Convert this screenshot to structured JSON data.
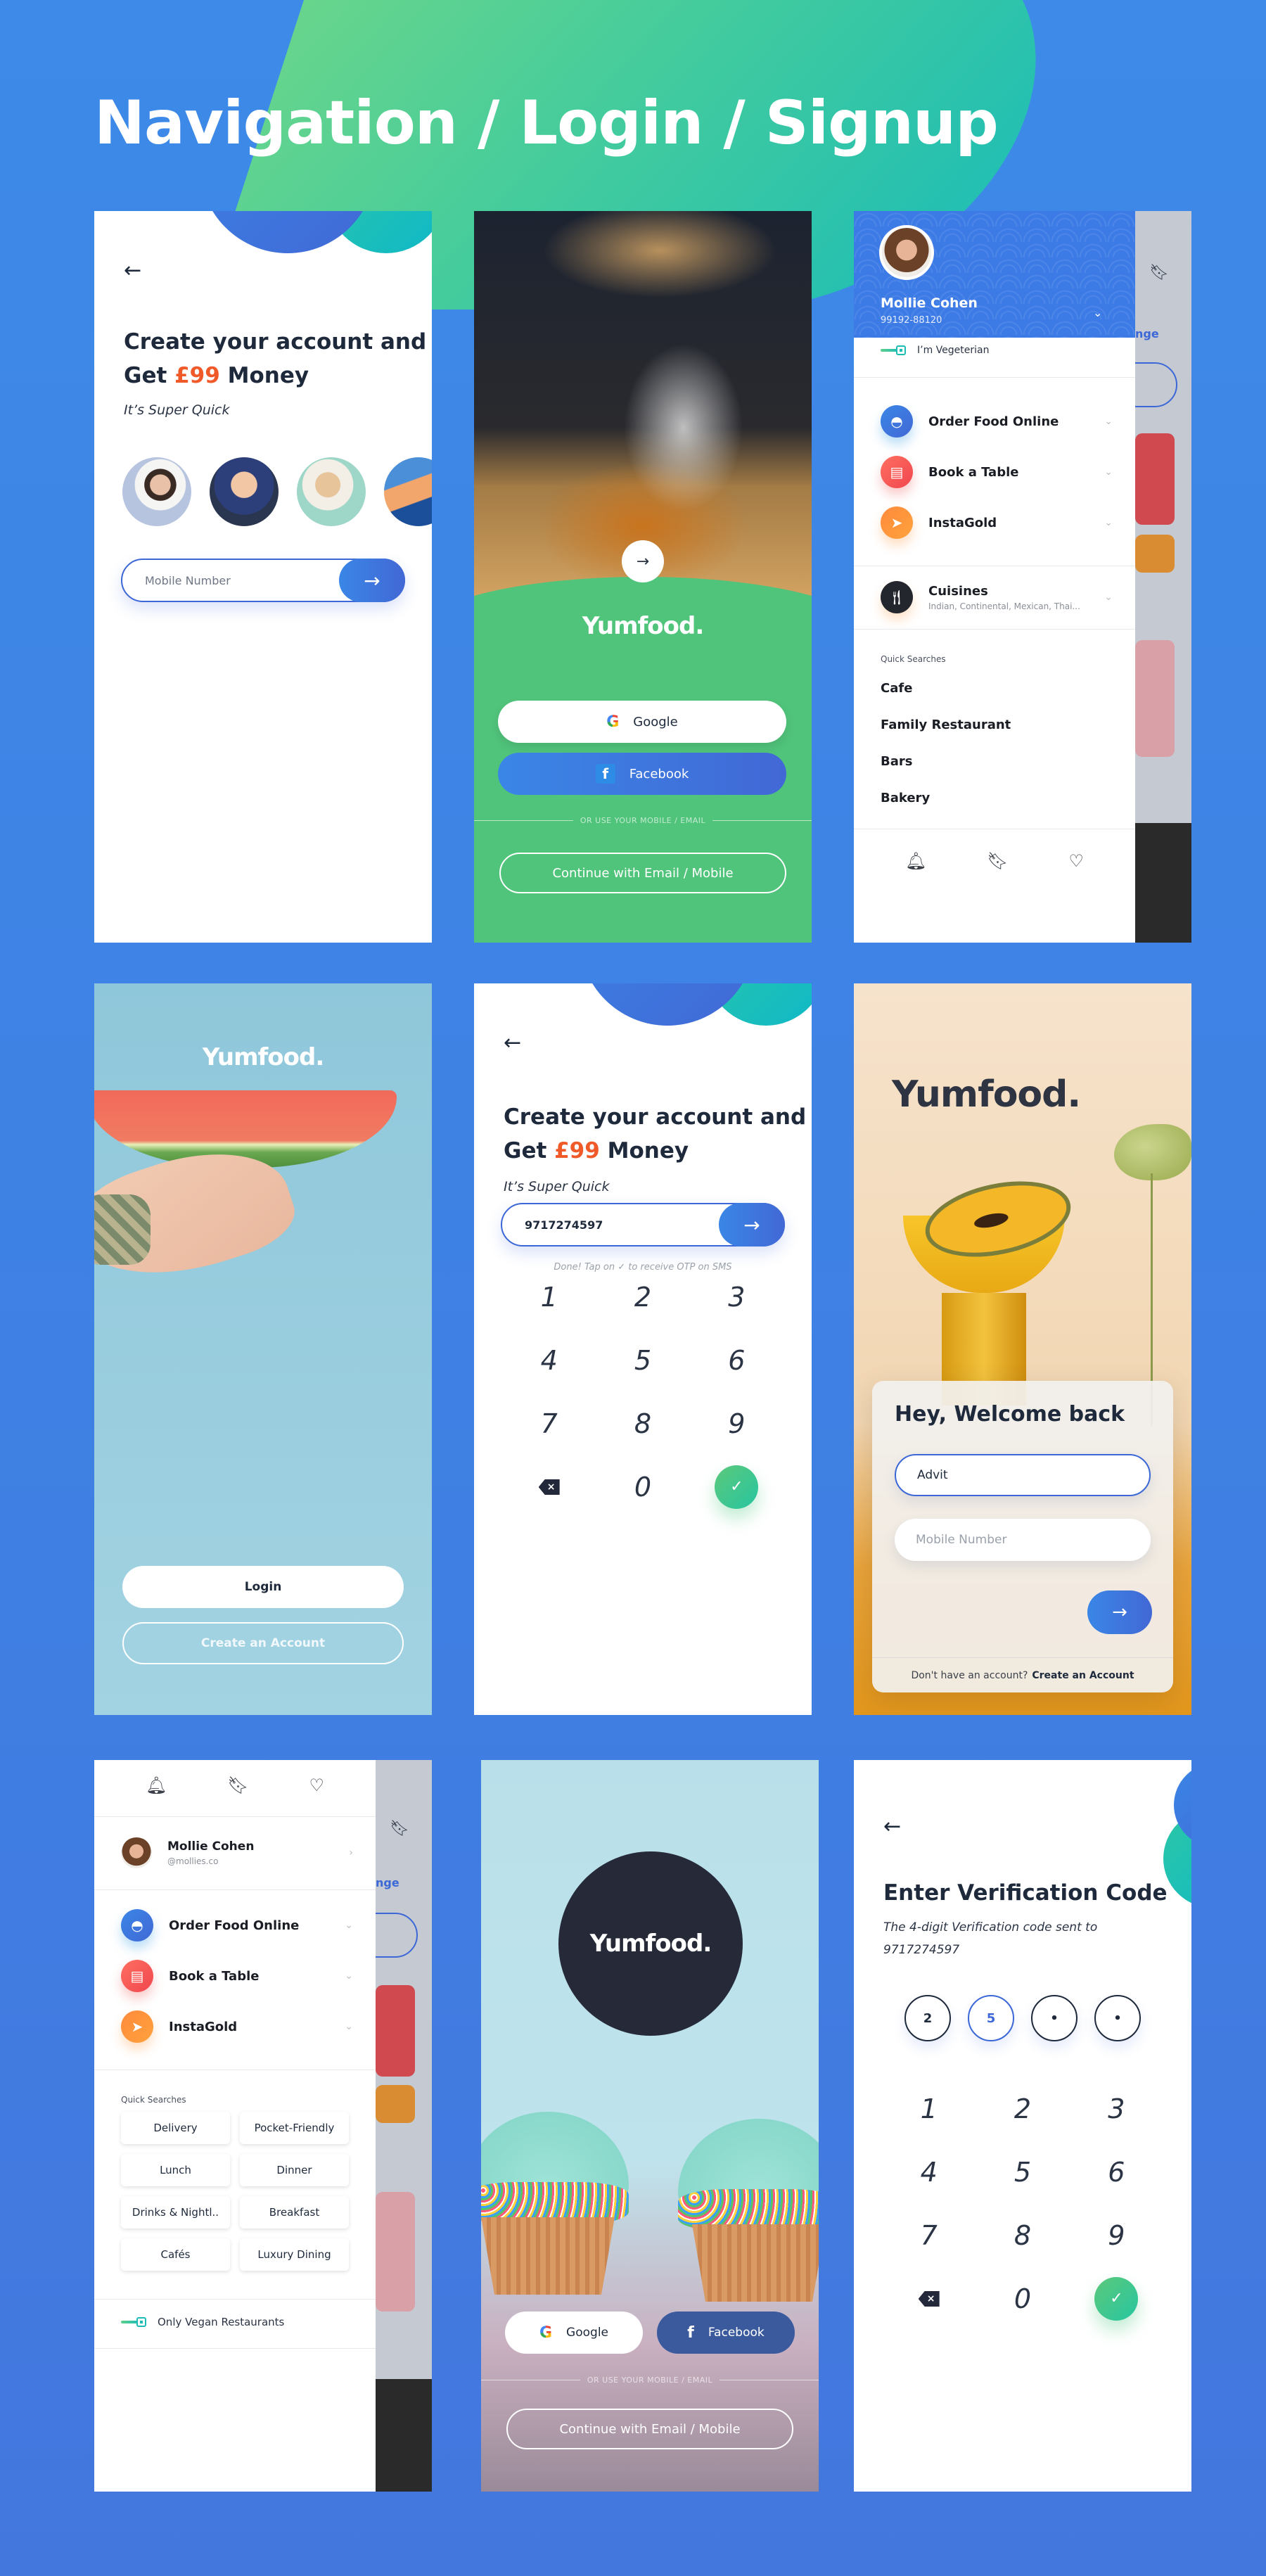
{
  "page": {
    "title": "Navigation / Login / Signup",
    "colors": {
      "background_blue": "#3d8ae8",
      "accent_green": "#51c47b",
      "accent_teal": "#1dbdb6",
      "primary_blue": "#3c67d6",
      "money_orange": "#f05a28",
      "dark_text": "#1e2a3b"
    }
  },
  "screens": {
    "signup_avatars": {
      "back_icon": "arrow-left-icon",
      "headline_line1": "Create your account and",
      "headline_get": "Get",
      "headline_money": "£99",
      "headline_tail": "Money",
      "subtitle": "It’s Super Quick",
      "avatars": [
        "woman in sunglasses",
        "boy with bow tie",
        "man in sunglasses",
        "woman in blue coat"
      ],
      "mobile_placeholder": "Mobile Number",
      "submit_icon": "arrow-right-icon"
    },
    "social_green": {
      "next_icon": "arrow-right-icon",
      "logo": "Yumfood.",
      "google_label": "Google",
      "facebook_label": "Facebook",
      "divider": "OR USE YOUR MOBILE / EMAIL",
      "continue_label": "Continue with Email / Mobile"
    },
    "drawer_blue": {
      "user_name": "Mollie Cohen",
      "user_phone": "99192-88120",
      "veg_toggle_label": "I’m Vegeterian",
      "menu": [
        {
          "label": "Order Food Online",
          "icon": "cloche-icon",
          "sub": ""
        },
        {
          "label": "Book a Table",
          "icon": "calendar-icon",
          "sub": ""
        },
        {
          "label": "InstaGold",
          "icon": "rocket-icon",
          "sub": ""
        },
        {
          "label": "Cuisines",
          "icon": "fork-knife-icon",
          "sub": "Indian, Continental, Mexican, Thai..."
        }
      ],
      "quick_searches_title": "Quick Searches",
      "quick_searches": [
        "Cafe",
        "Family Restaurant",
        "Bars",
        "Bakery"
      ],
      "behind_text": "nge"
    },
    "watermelon_welcome": {
      "logo": "Yumfood.",
      "login_label": "Login",
      "create_label": "Create an Account"
    },
    "signup_keypad": {
      "headline_line1": "Create your account and",
      "headline_get": "Get",
      "headline_money": "£99",
      "headline_tail": "Money",
      "subtitle": "It’s Super Quick",
      "mobile_value": "9717274597",
      "hint_before": "Done! Tap on",
      "hint_after": "to receive OTP on SMS",
      "keys": [
        "1",
        "2",
        "3",
        "4",
        "5",
        "6",
        "7",
        "8",
        "9",
        "⌫",
        "0",
        "✓"
      ]
    },
    "welcome_back": {
      "logo": "Yumfood.",
      "title": "Hey, Welcome back",
      "name_value": "Advit",
      "mobile_placeholder": "Mobile Number",
      "footer_text": "Don't have an account?",
      "footer_link": "Create an Account"
    },
    "drawer_chips": {
      "user_name": "Mollie Cohen",
      "user_handle": "@mollies.co",
      "menu": [
        {
          "label": "Order Food Online",
          "icon": "cloche-icon"
        },
        {
          "label": "Book a Table",
          "icon": "calendar-icon"
        },
        {
          "label": "InstaGold",
          "icon": "rocket-icon"
        }
      ],
      "quick_searches_title": "Quick Searches",
      "chips": [
        "Delivery",
        "Pocket-Friendly",
        "Lunch",
        "Dinner",
        "Drinks & Nightl..",
        "Breakfast",
        "Cafés",
        "Luxury Dining"
      ],
      "vegan_toggle_label": "Only Vegan Restaurants"
    },
    "cupcake_social": {
      "logo": "Yumfood.",
      "google_label": "Google",
      "facebook_label": "Facebook",
      "divider": "OR USE YOUR MOBILE / EMAIL",
      "continue_label": "Continue with Email / Mobile"
    },
    "verification": {
      "title": "Enter Verification Code",
      "subtitle": "The 4-digit Verification code sent to",
      "phone": "9717274597",
      "otp": [
        "2",
        "5",
        "•",
        "•"
      ],
      "keys": [
        "1",
        "2",
        "3",
        "4",
        "5",
        "6",
        "7",
        "8",
        "9",
        "⌫",
        "0",
        "✓"
      ]
    }
  }
}
